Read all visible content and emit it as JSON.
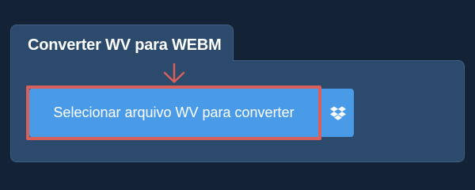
{
  "panel": {
    "title": "Converter WV para WEBM"
  },
  "actions": {
    "select_file_label": "Selecionar arquivo WV para converter",
    "dropbox_icon": "dropbox-icon"
  },
  "colors": {
    "background": "#132234",
    "panel": "#2c4a6c",
    "button": "#4a9be7",
    "highlight": "#d9605a",
    "text": "#ffffff"
  }
}
